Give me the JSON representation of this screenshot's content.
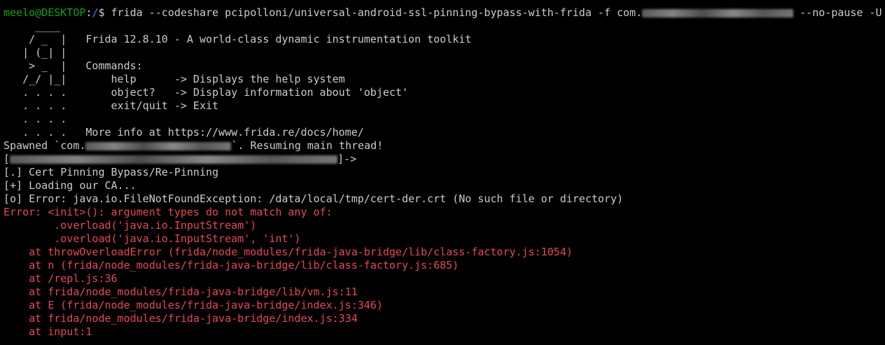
{
  "prompt": {
    "user_host": "meelo@DESKTOP",
    "colon": ":",
    "path": "/",
    "symbol": "$ ",
    "command_pre": "frida --codeshare pcipolloni/universal-android-ssl-pinning-bypass-with-frida -f com.",
    "command_post": " --no-pause -U"
  },
  "banner": [
    {
      "art": "     ____",
      "text": ""
    },
    {
      "art": "    / _  |",
      "text": "   Frida 12.8.10 - A world-class dynamic instrumentation toolkit"
    },
    {
      "art": "   | (_| |",
      "text": ""
    },
    {
      "art": "    > _  |",
      "text": "   Commands:"
    },
    {
      "art": "   /_/ |_|",
      "text": "       help      -> Displays the help system"
    },
    {
      "art": "   . . . .",
      "text": "       object?   -> Display information about 'object'"
    },
    {
      "art": "   . . . .",
      "text": "       exit/quit -> Exit"
    },
    {
      "art": "   . . . .",
      "text": ""
    },
    {
      "art": "   . . . .",
      "text": "   More info at https://www.frida.re/docs/home/"
    }
  ],
  "spawned": {
    "pre": "Spawned `com.",
    "post": "`. Resuming main thread!"
  },
  "repl_prompt": {
    "open": "[",
    "close": "]->"
  },
  "info_lines": [
    "[.] Cert Pinning Bypass/Re-Pinning",
    "[+] Loading our CA...",
    "[o] Error: java.io.FileNotFoundException: /data/local/tmp/cert-der.crt (No such file or directory)"
  ],
  "error_lines": [
    "Error: <init>(): argument types do not match any of:",
    "        .overload('java.io.InputStream')",
    "        .overload('java.io.InputStream', 'int')",
    "    at throwOverloadError (frida/node_modules/frida-java-bridge/lib/class-factory.js:1054)",
    "    at n (frida/node_modules/frida-java-bridge/lib/class-factory.js:685)",
    "    at /repl.js:36",
    "    at frida/node_modules/frida-java-bridge/lib/vm.js:11",
    "    at E (frida/node_modules/frida-java-bridge/index.js:346)",
    "    at frida/node_modules/frida-java-bridge/index.js:334",
    "    at input:1"
  ],
  "colors": {
    "background": "#000000",
    "text": "#cccccc",
    "prompt_user": "#13a10e",
    "prompt_path": "#3b78ff",
    "error": "#e74856"
  }
}
